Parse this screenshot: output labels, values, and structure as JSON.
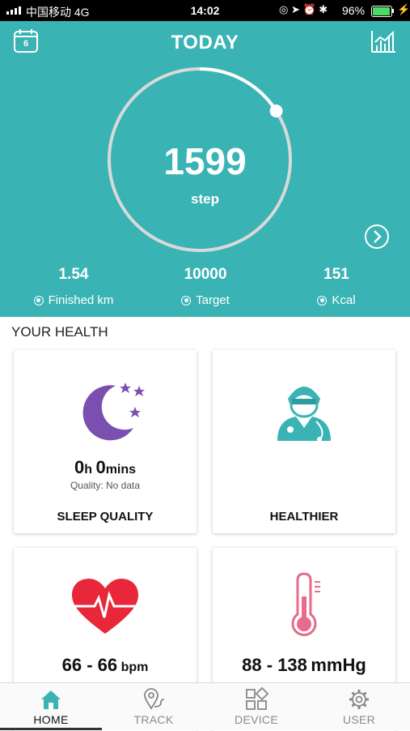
{
  "status_bar": {
    "carrier": "中国移动  4G",
    "time": "14:02",
    "battery": "96%"
  },
  "header": {
    "title": "TODAY",
    "calendar_day": "6",
    "steps": "1599",
    "steps_unit": "step",
    "goal_progress": 0.16,
    "stats": [
      {
        "value": "1.54",
        "label": "Finished km"
      },
      {
        "value": "10000",
        "label": "Target"
      },
      {
        "value": "151",
        "label": "Kcal"
      }
    ]
  },
  "health": {
    "section_title": "YOUR HEALTH",
    "sleep": {
      "hours": "0",
      "h_unit": "h",
      "mins": "0",
      "m_unit": "mins",
      "quality": "Quality: No data",
      "name": "SLEEP QUALITY"
    },
    "healthier": {
      "name": "HEALTHIER"
    },
    "heart": {
      "value": "66 - 66",
      "unit": "bpm"
    },
    "pressure": {
      "value": "88 - 138",
      "unit": "mmHg"
    }
  },
  "tabs": [
    {
      "label": "HOME",
      "icon": "home-icon",
      "active": true
    },
    {
      "label": "TRACK",
      "icon": "track-icon",
      "active": false
    },
    {
      "label": "DEVICE",
      "icon": "device-icon",
      "active": false
    },
    {
      "label": "USER",
      "icon": "gear-icon",
      "active": false
    }
  ],
  "colors": {
    "primary": "#3ab3b4",
    "sleep": "#7b4fb0",
    "heart": "#e8273a",
    "thermometer": "#e86a8c"
  }
}
